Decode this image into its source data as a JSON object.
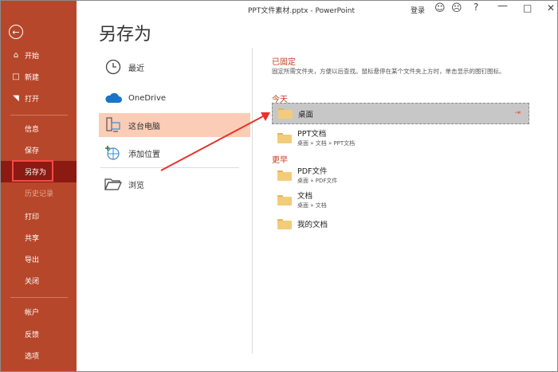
{
  "titlebar": {
    "title": "PPT文件素材.pptx  -  PowerPoint",
    "login": "登录"
  },
  "sidebar": {
    "back_icon": "back-arrow-icon",
    "items": [
      {
        "label": "开始",
        "icon": "home-icon"
      },
      {
        "label": "新建",
        "icon": "new-doc-icon"
      },
      {
        "label": "打开",
        "icon": "open-folder-icon"
      },
      {
        "label": "信息"
      },
      {
        "label": "保存"
      },
      {
        "label": "另存为"
      },
      {
        "label": "历史记录"
      },
      {
        "label": "打印"
      },
      {
        "label": "共享"
      },
      {
        "label": "导出"
      },
      {
        "label": "关闭"
      },
      {
        "label": "帐户"
      },
      {
        "label": "反馈"
      },
      {
        "label": "选项"
      }
    ]
  },
  "main": {
    "title": "另存为",
    "locations": [
      {
        "label": "最近",
        "icon": "clock-icon"
      },
      {
        "label": "OneDrive",
        "icon": "cloud-icon"
      },
      {
        "label": "这台电脑",
        "icon": "computer-icon"
      },
      {
        "label": "添加位置",
        "icon": "add-location-icon"
      },
      {
        "label": "浏览",
        "icon": "folder-open-icon"
      }
    ],
    "pinned": {
      "heading": "已固定",
      "description": "固定所需文件夹，方便以后查找。鼠标悬停在某个文件夹上方时，单击显示的图钉图标。"
    },
    "today": {
      "heading": "今天",
      "folders": [
        {
          "name": "桌面",
          "path": ""
        }
      ]
    },
    "recent_unlabeled": [
      {
        "name": "PPT文档",
        "path": "桌面 » 文档 » PPT文档"
      }
    ],
    "earlier": {
      "heading": "更早",
      "folders": [
        {
          "name": "PDF文件",
          "path": "桌面 » PDF文件"
        },
        {
          "name": "文档",
          "path": "桌面 » 文档"
        },
        {
          "name": "我的文档",
          "path": ""
        }
      ]
    }
  },
  "colors": {
    "sidebar": "#b7472a",
    "sidebar_active": "#8b1a13",
    "accent": "#c43e1c",
    "selected_location": "#fbcdb6",
    "annotation": "#e8322d"
  }
}
